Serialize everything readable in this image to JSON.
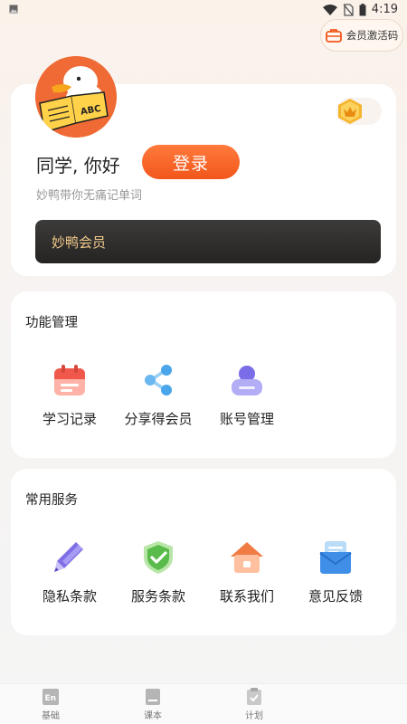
{
  "status_bar": {
    "time": "4:19"
  },
  "activation": {
    "label": "会员激活码"
  },
  "profile": {
    "greeting": "同学, 你好",
    "login_label": "登录",
    "subtitle": "妙鸭带你无痛记单词",
    "avatar_text": "ABC",
    "vip_label": "妙鸭会员"
  },
  "functions": {
    "title": "功能管理",
    "items": [
      {
        "label": "学习记录",
        "icon": "calendar-icon"
      },
      {
        "label": "分享得会员",
        "icon": "share-icon"
      },
      {
        "label": "账号管理",
        "icon": "user-icon"
      }
    ]
  },
  "services": {
    "title": "常用服务",
    "items": [
      {
        "label": "隐私条款",
        "icon": "pencil-icon"
      },
      {
        "label": "服务条款",
        "icon": "shield-check-icon"
      },
      {
        "label": "联系我们",
        "icon": "house-icon"
      },
      {
        "label": "意见反馈",
        "icon": "mail-icon"
      }
    ]
  },
  "tabbar": {
    "items": [
      {
        "label": "基础",
        "icon": "en-book-icon",
        "glyph": "En"
      },
      {
        "label": "课本",
        "icon": "textbook-icon"
      },
      {
        "label": "计划",
        "icon": "clipboard-icon"
      }
    ]
  },
  "colors": {
    "accent": "#f2561b",
    "vip_text": "#f0c98a",
    "vip_bg": "#2d2b29"
  }
}
